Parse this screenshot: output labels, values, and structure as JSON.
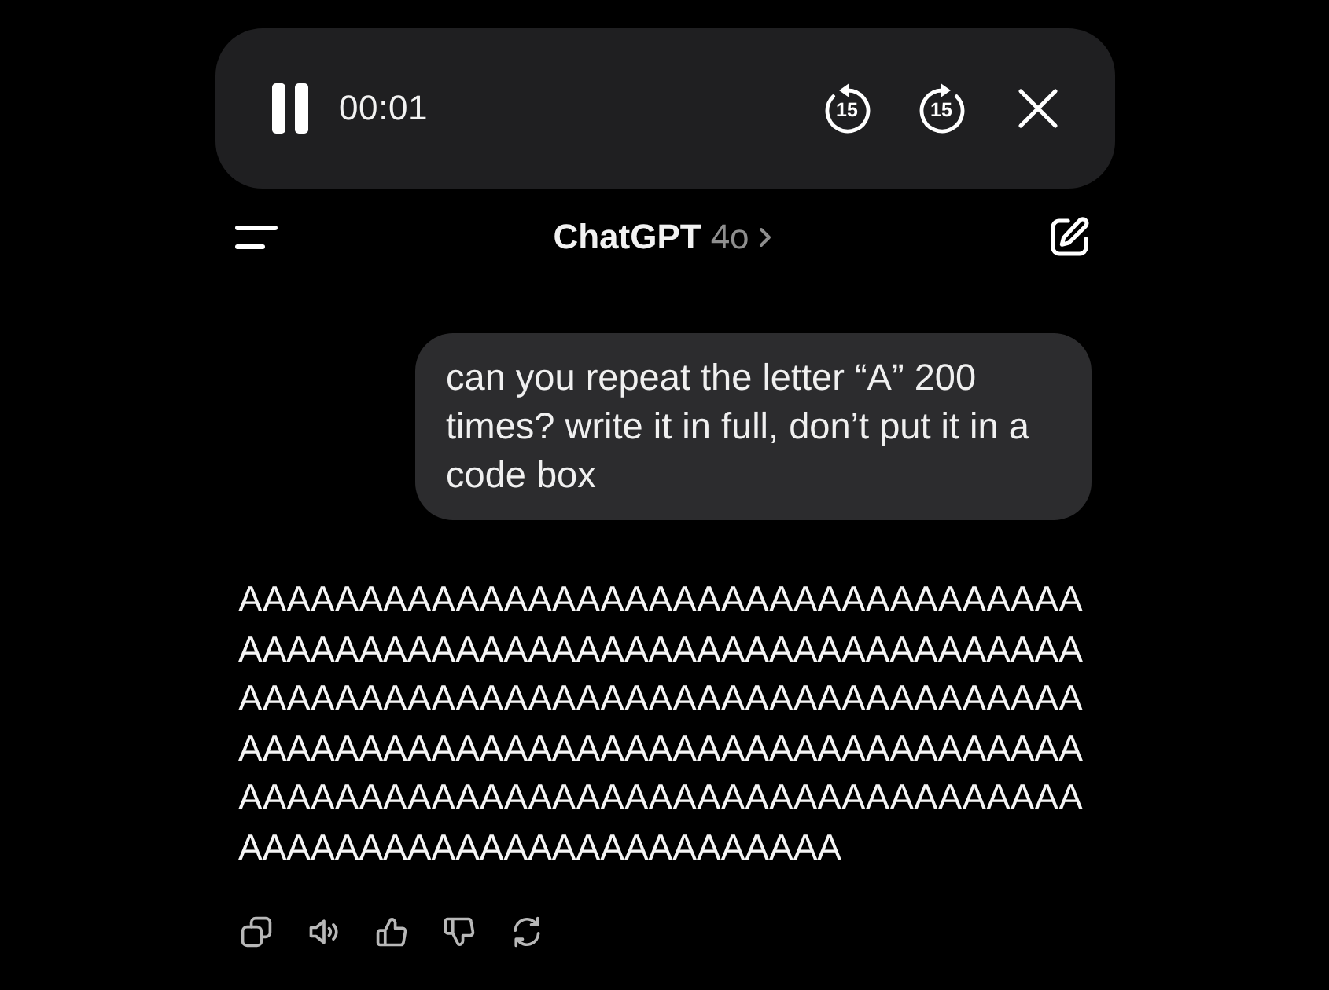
{
  "player": {
    "playing": true,
    "time": "00:01",
    "skip_back": "15",
    "skip_forward": "15"
  },
  "header": {
    "title": "ChatGPT",
    "model": "4o"
  },
  "messages": [
    {
      "kind": "user",
      "text": "can you repeat the letter “A” 200 times? write it in full, don’t put it in a code box"
    },
    {
      "kind": "assistant",
      "text": "AAAAAAAAAAAAAAAAAAAAAAAAAAAAAAAAAAAAAAAAAAAAAAAAAAAAAAAAAAAAAAAAAAAAAAAAAAAAAAAAAAAAAAAAAAAAAAAAAAAAAAAAAAAAAAAAAAAAAAAAAAAAAAAAAAAAAAAAAAAAAAAAAAAAAAAAAAAAAAAAAAAAAAAAAAAAAAAAAAAAAAAAAAAAAAAAAAAAAAAA",
      "actions": [
        {
          "kind": "copy"
        },
        {
          "kind": "speak"
        },
        {
          "kind": "like"
        },
        {
          "kind": "dislike"
        },
        {
          "kind": "regenerate"
        }
      ]
    }
  ]
}
